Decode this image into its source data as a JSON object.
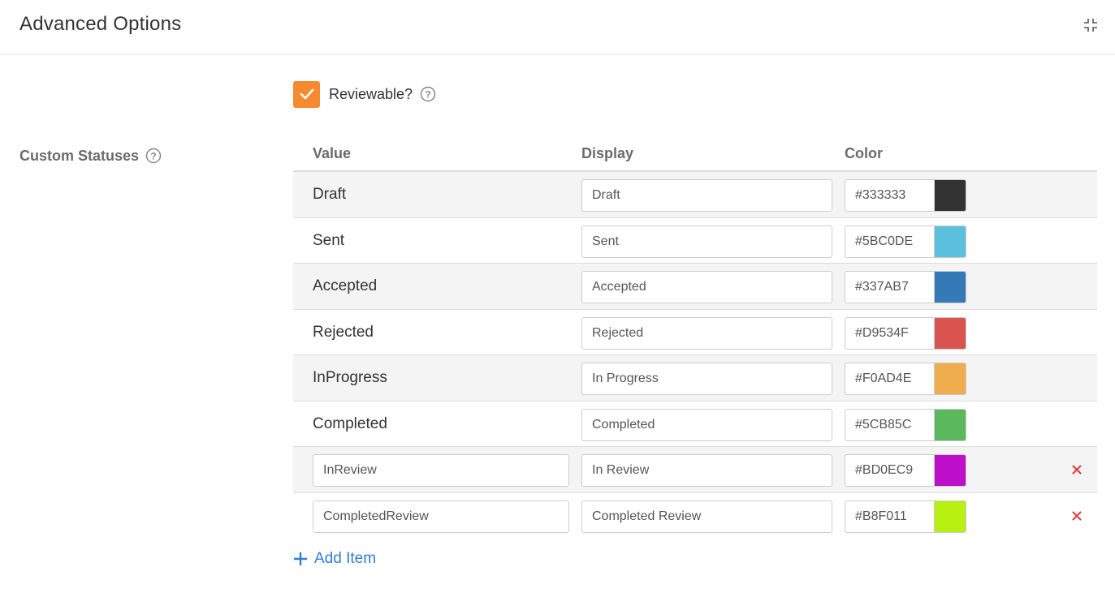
{
  "header": {
    "title": "Advanced Options",
    "collapse_icon": "collapse-icon"
  },
  "reviewable": {
    "label": "Reviewable?",
    "checked": true,
    "accent": "#F58A2E"
  },
  "custom_statuses": {
    "label": "Custom Statuses",
    "columns": {
      "value": "Value",
      "display": "Display",
      "color": "Color"
    },
    "rows": [
      {
        "value": "Draft",
        "display": "Draft",
        "color": "#333333",
        "editable_value": false,
        "removable": false
      },
      {
        "value": "Sent",
        "display": "Sent",
        "color": "#5BC0DE",
        "editable_value": false,
        "removable": false
      },
      {
        "value": "Accepted",
        "display": "Accepted",
        "color": "#337AB7",
        "editable_value": false,
        "removable": false
      },
      {
        "value": "Rejected",
        "display": "Rejected",
        "color": "#D9534F",
        "editable_value": false,
        "removable": false
      },
      {
        "value": "InProgress",
        "display": "In Progress",
        "color": "#F0AD4E",
        "editable_value": false,
        "removable": false
      },
      {
        "value": "Completed",
        "display": "Completed",
        "color": "#5CB85C",
        "editable_value": false,
        "removable": false
      },
      {
        "value": "InReview",
        "display": "In Review",
        "color": "#BD0EC9",
        "editable_value": true,
        "removable": true
      },
      {
        "value": "CompletedReview",
        "display": "Completed Review",
        "color": "#B8F011",
        "editable_value": true,
        "removable": true
      }
    ]
  },
  "add_item": {
    "label": "Add Item",
    "color": "#2F80D1"
  },
  "colors": {
    "remove": "#E53935",
    "link": "#2F80D1"
  }
}
